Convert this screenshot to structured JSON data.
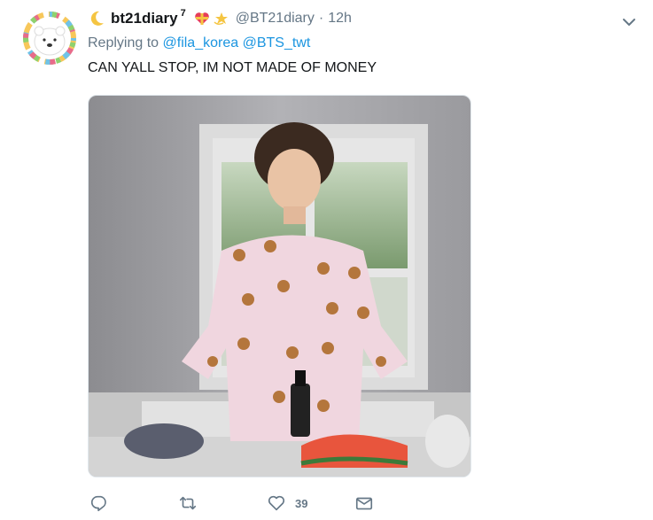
{
  "tweet": {
    "display_name": "bt21diary",
    "superscript": "7",
    "handle": "@BT21diary",
    "separator": "·",
    "time": "12h",
    "replying_prefix": "Replying to",
    "replying_to": [
      "@fila_korea",
      "@BTS_twt"
    ],
    "text": "CAN YALL STOP, IM NOT MADE OF MONEY"
  },
  "actions": {
    "like_count": "39"
  },
  "colors": {
    "link": "#1b95e0",
    "muted": "#657786",
    "text": "#14171a"
  },
  "icons": {
    "name_emoji_1": "crescent-moon-icon",
    "name_emoji_2": "heart-ribbon-icon",
    "name_emoji_3": "dizzy-star-icon",
    "menu": "chevron-down-icon",
    "reply": "reply-icon",
    "retweet": "retweet-icon",
    "like": "heart-icon",
    "dm": "envelope-icon"
  }
}
